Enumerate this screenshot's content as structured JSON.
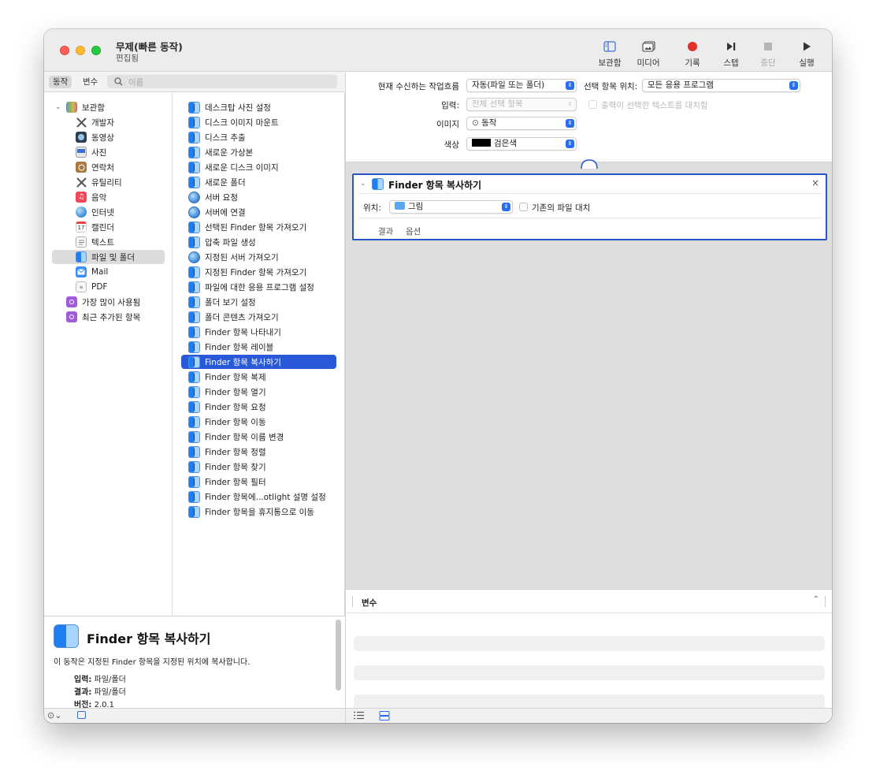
{
  "window": {
    "title": "무제(빠른 동작)",
    "subtitle": "편집됨"
  },
  "toolbar": {
    "buttons": [
      {
        "label": "보관함",
        "icon": "library-sidebar-icon",
        "enabled": true
      },
      {
        "label": "미디어",
        "icon": "media-photos-icon",
        "enabled": true
      },
      {
        "label": "기록",
        "icon": "record-icon",
        "enabled": true
      },
      {
        "label": "스텝",
        "icon": "step-icon",
        "enabled": true
      },
      {
        "label": "중단",
        "icon": "stop-icon",
        "enabled": false
      },
      {
        "label": "실행",
        "icon": "play-icon",
        "enabled": true
      }
    ]
  },
  "leftbar": {
    "segments": [
      "동작",
      "변수"
    ],
    "selected_segment": "동작",
    "search_placeholder": "이름"
  },
  "library": {
    "root": "보관함",
    "items": [
      {
        "label": "개발자",
        "icon": "developer-tools-icon"
      },
      {
        "label": "동영상",
        "icon": "movie-icon"
      },
      {
        "label": "사진",
        "icon": "photos-icon"
      },
      {
        "label": "연락처",
        "icon": "contacts-icon"
      },
      {
        "label": "유틸리티",
        "icon": "utilities-icon"
      },
      {
        "label": "음악",
        "icon": "music-icon"
      },
      {
        "label": "인터넷",
        "icon": "internet-globe-icon"
      },
      {
        "label": "캘린더",
        "icon": "calendar-icon"
      },
      {
        "label": "텍스트",
        "icon": "text-icon"
      },
      {
        "label": "파일 및 폴더",
        "icon": "finder-icon",
        "selected": true
      },
      {
        "label": "Mail",
        "icon": "mail-icon"
      },
      {
        "label": "PDF",
        "icon": "pdf-icon"
      }
    ],
    "smart_groups": [
      {
        "label": "가장 많이 사용됨",
        "icon": "smart-folder-icon"
      },
      {
        "label": "최근 추가된 항목",
        "icon": "smart-folder-icon"
      }
    ]
  },
  "actions": {
    "selected": "Finder 항목 복사하기",
    "items": [
      {
        "label": "데스크탑 사진 설정",
        "icon": "finder"
      },
      {
        "label": "디스크 이미지 마운트",
        "icon": "finder"
      },
      {
        "label": "디스크 추출",
        "icon": "finder"
      },
      {
        "label": "새로운 가상본",
        "icon": "finder"
      },
      {
        "label": "새로운 디스크 이미지",
        "icon": "finder"
      },
      {
        "label": "새로운 폴더",
        "icon": "finder"
      },
      {
        "label": "서버 요청",
        "icon": "globe"
      },
      {
        "label": "서버에 연결",
        "icon": "globe"
      },
      {
        "label": "선택된 Finder 항목 가져오기",
        "icon": "finder"
      },
      {
        "label": "압축 파일 생성",
        "icon": "finder"
      },
      {
        "label": "지정된 서버 가져오기",
        "icon": "globe"
      },
      {
        "label": "지정된 Finder 항목 가져오기",
        "icon": "finder"
      },
      {
        "label": "파일에 대한 응용 프로그램 설정",
        "icon": "finder"
      },
      {
        "label": "폴더 보기 설정",
        "icon": "finder"
      },
      {
        "label": "폴더 콘텐츠 가져오기",
        "icon": "finder"
      },
      {
        "label": "Finder 항목 나타내기",
        "icon": "finder"
      },
      {
        "label": "Finder 항목 레이블",
        "icon": "finder"
      },
      {
        "label": "Finder 항목 복사하기",
        "icon": "finder"
      },
      {
        "label": "Finder 항목 복제",
        "icon": "finder"
      },
      {
        "label": "Finder 항목 열기",
        "icon": "finder"
      },
      {
        "label": "Finder 항목 요청",
        "icon": "finder"
      },
      {
        "label": "Finder 항목 이동",
        "icon": "finder"
      },
      {
        "label": "Finder 항목 이름 변경",
        "icon": "finder"
      },
      {
        "label": "Finder 항목 정렬",
        "icon": "finder"
      },
      {
        "label": "Finder 항목 찾기",
        "icon": "finder"
      },
      {
        "label": "Finder 항목 필터",
        "icon": "finder"
      },
      {
        "label": "Finder 항목에...otlight 설명 설정",
        "icon": "finder"
      },
      {
        "label": "Finder 항목을 휴지통으로 이동",
        "icon": "finder"
      }
    ]
  },
  "description": {
    "title": "Finder 항목 복사하기",
    "text": "이 동작은 지정된 Finder 항목을 지정된 위치에 복사합니다.",
    "input_label": "입력:",
    "input_value": "파일/폴더",
    "result_label": "결과:",
    "result_value": "파일/폴더",
    "version_label": "버전:",
    "version_value": "2.0.1"
  },
  "workflow_header": {
    "receives_label": "현재 수신하는 작업흐름",
    "receives_value": "자동(파일 또는 폴더)",
    "in_label": "선택 항목 위치:",
    "in_value": "모든 응용 프로그램",
    "input_label": "입력:",
    "input_value": "전체 선택 항목",
    "replace_label": "출력이 선택한 텍스트를 대치함",
    "image_label": "이미지",
    "image_value": "동작",
    "color_label": "색상",
    "color_value": "검은색",
    "color_swatch": "#000000"
  },
  "action_card": {
    "title": "Finder 항목 복사하기",
    "location_label": "위치:",
    "location_value": "그림",
    "replace_label": "기존의 파일 대치",
    "tabs": [
      "결과",
      "옵션"
    ]
  },
  "variables": {
    "header": "변수"
  },
  "colors": {
    "accent": "#2959d9",
    "card_border": "#2856c7",
    "record": "#e0322d"
  }
}
